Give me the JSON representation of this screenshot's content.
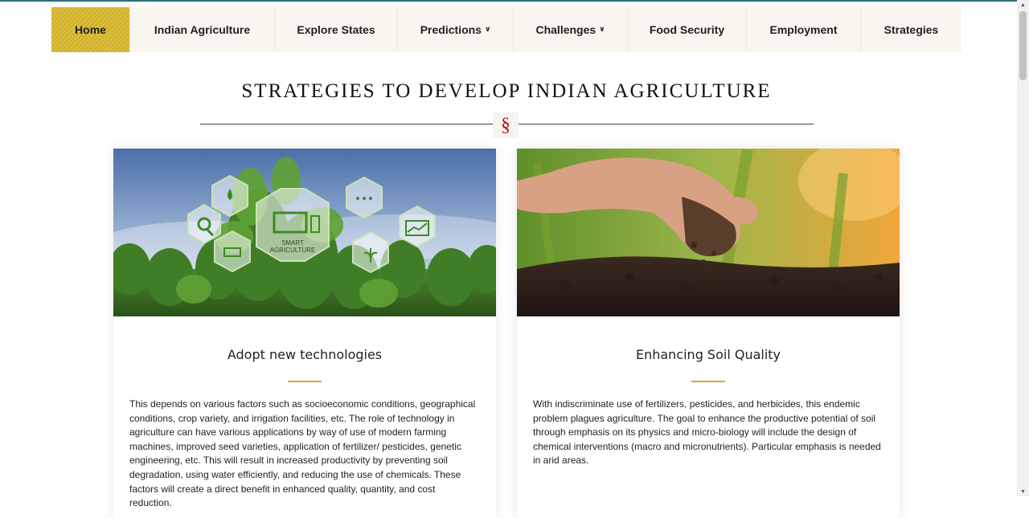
{
  "nav": {
    "items": [
      {
        "label": "Home",
        "active": true
      },
      {
        "label": "Indian Agriculture"
      },
      {
        "label": "Explore States"
      },
      {
        "label": "Predictions",
        "dropdown": true
      },
      {
        "label": "Challenges",
        "dropdown": true
      },
      {
        "label": "Food Security"
      },
      {
        "label": "Employment"
      },
      {
        "label": "Strategies"
      }
    ],
    "accent_color": "#d9b92b"
  },
  "page": {
    "title": "STRATEGIES TO DEVELOP INDIAN AGRICULTURE",
    "divider_symbol": "§"
  },
  "cards": [
    {
      "heading": "Adopt new technologies",
      "image_badge": "SMART AGRICULTURE",
      "text": "This depends on various factors such as socioeconomic conditions, geographical conditions, crop variety, and irrigation facilities, etc. The role of technology in agriculture can have various applications by way of use of modern farming machines, improved seed varieties, application of fertilizer/ pesticides, genetic engineering, etc. This will result in increased productivity by preventing soil degradation, using water efficiently, and reducing the use of chemicals. These factors will create a direct benefit in enhanced quality, quantity, and cost reduction."
    },
    {
      "heading": "Enhancing Soil Quality",
      "text": "With indiscriminate use of fertilizers, pesticides, and herbicides, this endemic problem plagues agriculture. The goal to enhance the productive potential of soil through emphasis on its physics and micro-biology will include the design of chemical interventions (macro and micronutrients). Particular emphasis is needed in arid areas."
    }
  ]
}
